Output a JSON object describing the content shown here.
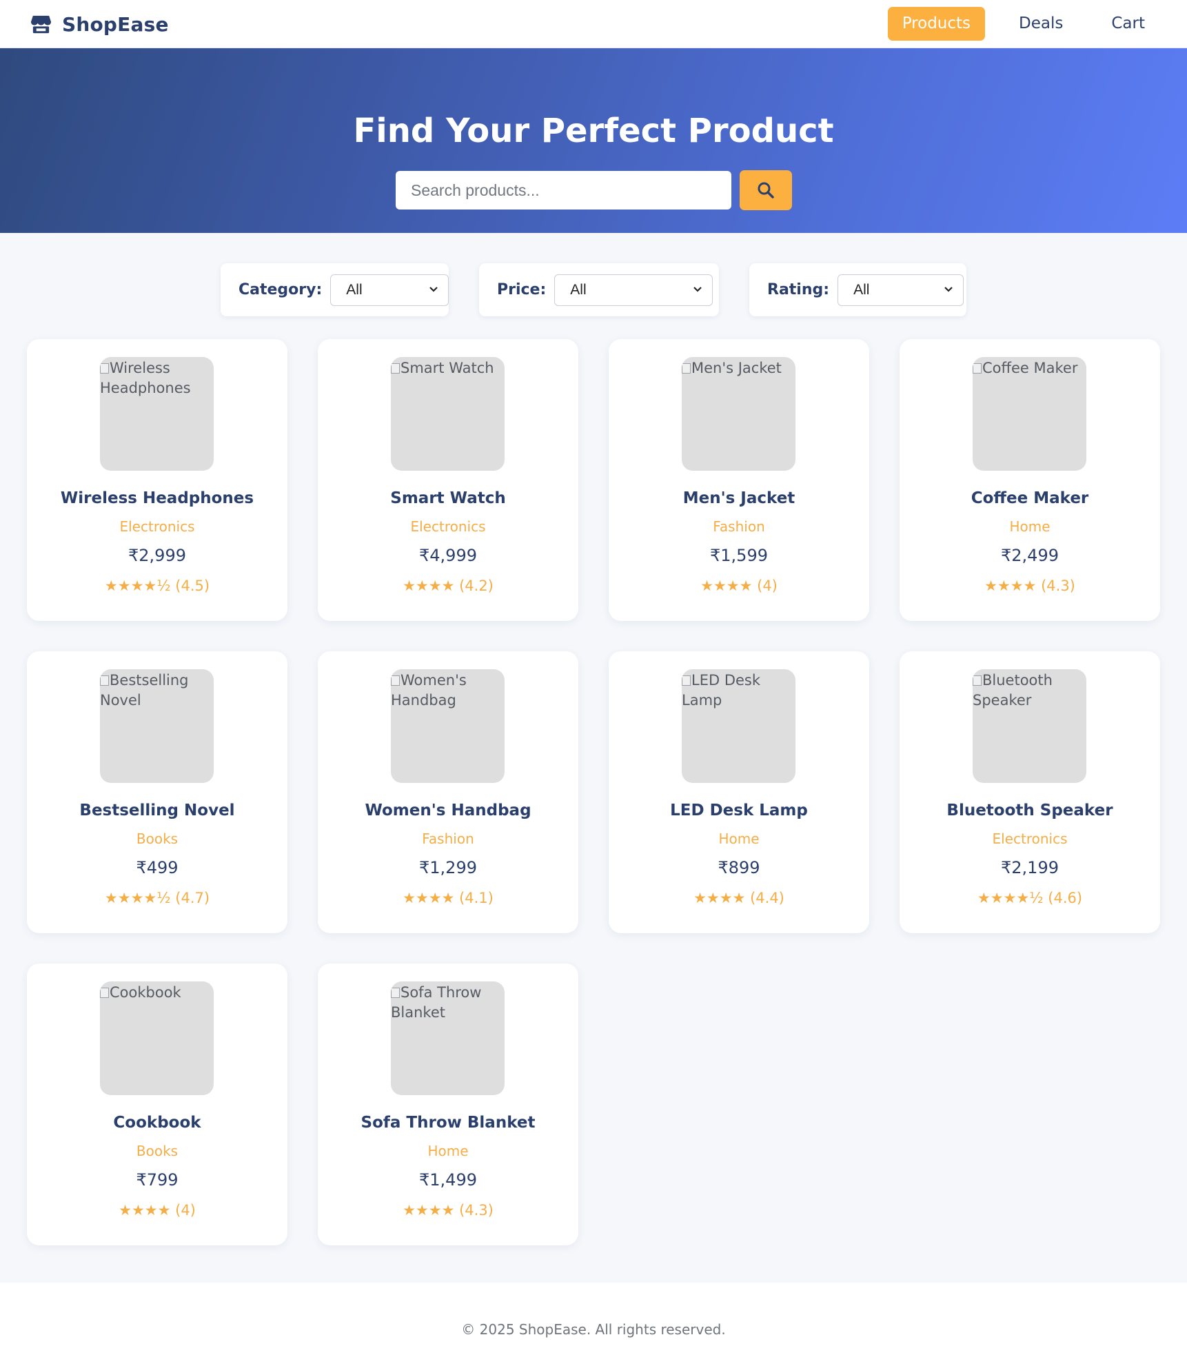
{
  "brand": {
    "name": "ShopEase",
    "icon": "store-icon"
  },
  "nav": {
    "items": [
      "Products",
      "Deals",
      "Cart"
    ],
    "active": "Products"
  },
  "hero": {
    "title": "Find Your Perfect Product",
    "search_placeholder": "Search products...",
    "search_icon": "search-icon"
  },
  "filters": [
    {
      "label": "Category:",
      "value": "All"
    },
    {
      "label": "Price:",
      "value": "All"
    },
    {
      "label": "Rating:",
      "value": "All"
    }
  ],
  "products": [
    {
      "name": "Wireless Headphones",
      "img_alt": "Wireless Headphones",
      "category": "Electronics",
      "price": "₹2,999",
      "stars": "★★★★½",
      "rating_text": "(4.5)",
      "rating": 4.5
    },
    {
      "name": "Smart Watch",
      "img_alt": "Smart Watch",
      "category": "Electronics",
      "price": "₹4,999",
      "stars": "★★★★",
      "rating_text": "(4.2)",
      "rating": 4.2
    },
    {
      "name": "Men's Jacket",
      "img_alt": "Men's Jacket",
      "category": "Fashion",
      "price": "₹1,599",
      "stars": "★★★★",
      "rating_text": "(4)",
      "rating": 4
    },
    {
      "name": "Coffee Maker",
      "img_alt": "Coffee Maker",
      "category": "Home",
      "price": "₹2,499",
      "stars": "★★★★",
      "rating_text": "(4.3)",
      "rating": 4.3
    },
    {
      "name": "Bestselling Novel",
      "img_alt": "Bestselling Novel",
      "category": "Books",
      "price": "₹499",
      "stars": "★★★★½",
      "rating_text": "(4.7)",
      "rating": 4.7
    },
    {
      "name": "Women's Handbag",
      "img_alt": "Women's Handbag",
      "category": "Fashion",
      "price": "₹1,299",
      "stars": "★★★★",
      "rating_text": "(4.1)",
      "rating": 4.1
    },
    {
      "name": "LED Desk Lamp",
      "img_alt": "LED Desk Lamp",
      "category": "Home",
      "price": "₹899",
      "stars": "★★★★",
      "rating_text": "(4.4)",
      "rating": 4.4
    },
    {
      "name": "Bluetooth Speaker",
      "img_alt": "Bluetooth Speaker",
      "category": "Electronics",
      "price": "₹2,199",
      "stars": "★★★★½",
      "rating_text": "(4.6)",
      "rating": 4.6
    },
    {
      "name": "Cookbook",
      "img_alt": "Cookbook",
      "category": "Books",
      "price": "₹799",
      "stars": "★★★★",
      "rating_text": "(4)",
      "rating": 4
    },
    {
      "name": "Sofa Throw Blanket",
      "img_alt": "Sofa Throw Blanket",
      "category": "Home",
      "price": "₹1,499",
      "stars": "★★★★",
      "rating_text": "(4.3)",
      "rating": 4.3
    }
  ],
  "footer": {
    "text": "© 2025 ShopEase. All rights reserved."
  },
  "colors": {
    "primary": "#2b3f6c",
    "accent": "#fbb040",
    "hero_gradient_start": "#2f4a7e",
    "hero_gradient_end": "#5c7df6",
    "page_background": "#f5f7fb"
  }
}
